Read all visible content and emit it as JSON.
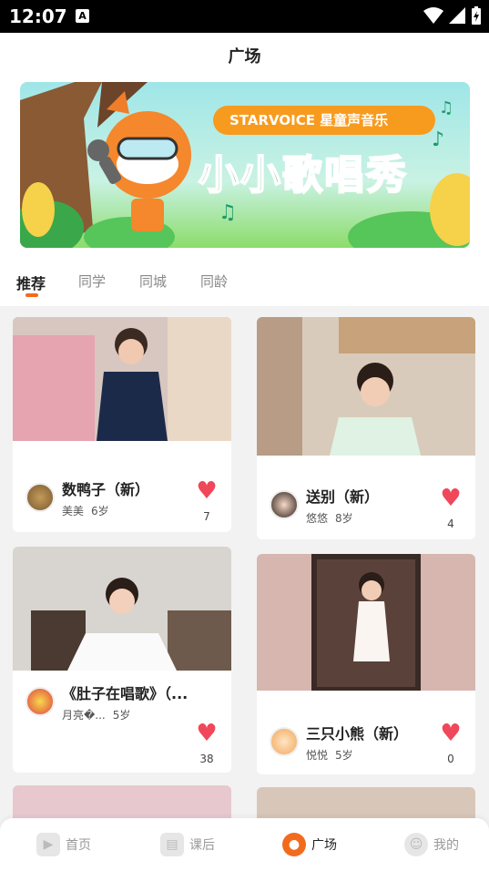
{
  "status": {
    "time": "12:07",
    "notification_letter": "A"
  },
  "page": {
    "title": "广场"
  },
  "banner": {
    "brand": "STARVOICE 星童声音乐",
    "headline": "小小歌唱秀"
  },
  "tabs": [
    {
      "label": "推荐",
      "active": true
    },
    {
      "label": "同学",
      "active": false
    },
    {
      "label": "同城",
      "active": false
    },
    {
      "label": "同龄",
      "active": false
    }
  ],
  "cards": [
    {
      "song": "数鸭子（新）",
      "user": "美美",
      "age": "6岁",
      "likes": "7"
    },
    {
      "song": "送别（新）",
      "user": "悠悠",
      "age": "8岁",
      "likes": "4"
    },
    {
      "song": "《肚子在唱歌》（...",
      "user": "月亮�...",
      "age": "5岁",
      "likes": "38"
    },
    {
      "song": "三只小熊（新）",
      "user": "悦悦",
      "age": "5岁",
      "likes": "0"
    }
  ],
  "nav": [
    {
      "label": "首页",
      "icon": "play-icon",
      "active": false
    },
    {
      "label": "课后",
      "icon": "book-icon",
      "active": false
    },
    {
      "label": "广场",
      "icon": "flame-icon",
      "active": true
    },
    {
      "label": "我的",
      "icon": "face-icon",
      "active": false
    }
  ],
  "colors": {
    "accent": "#f26b1d",
    "heart": "#f0475a"
  }
}
